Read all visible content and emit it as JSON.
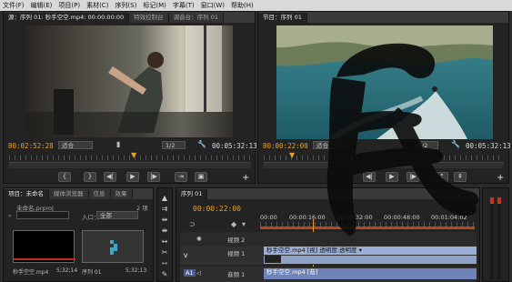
{
  "menu": [
    "文件(F)",
    "编辑(E)",
    "项目(P)",
    "素材(C)",
    "序列(S)",
    "标记(M)",
    "字幕(T)",
    "窗口(W)",
    "帮助(H)"
  ],
  "source_panel": {
    "tabs": [
      "源：序列 01: 秒手空空.mp4: 00:00:00:00",
      "特效控制台",
      "调音台：序列 01"
    ],
    "timecode_in": "00:02:52:28",
    "fit": "适合",
    "resolution": "1/2",
    "timecode_dur": "00:05:32:13"
  },
  "program_panel": {
    "tabs": [
      "节目：序列 01"
    ],
    "timecode_in": "00:00:22:00",
    "fit": "适合",
    "resolution": "1/2",
    "timecode_dur": "00:05:32:13"
  },
  "project_panel": {
    "tabs": [
      "项目：未命名",
      "媒体浏览器",
      "信息",
      "效果"
    ],
    "file": "未命名.prproj",
    "count": "2 项",
    "filter_label": "入口：",
    "filter_value": "全部",
    "items": [
      {
        "name": "秒手空空.mp4",
        "duration": "5;32;14"
      },
      {
        "name": "序列 01",
        "duration": "5;32;13"
      }
    ]
  },
  "timeline_panel": {
    "tabs": [
      "序列 01"
    ],
    "timecode": "00:00:22:00",
    "ruler": [
      "00:00",
      "00:00:16:00",
      "00:00:32:00",
      "00:00:48:00",
      "00:01:04:02"
    ],
    "tracks": [
      {
        "label": "视频 2"
      },
      {
        "label": "视频 1",
        "clip": "秒手空空.mp4 [视] 透明度:透明度 ▾"
      },
      {
        "label": "音频 1",
        "clip": "秒手空空.mp4 [音]"
      }
    ],
    "track_ids": [
      "V",
      "A1"
    ]
  },
  "overlay": {
    "character": "民"
  },
  "colors": {
    "accent_orange": "#e8a02a",
    "clip_video": "#9aaed6",
    "clip_audio": "#6f83b8",
    "panel_bg": "#232323"
  }
}
